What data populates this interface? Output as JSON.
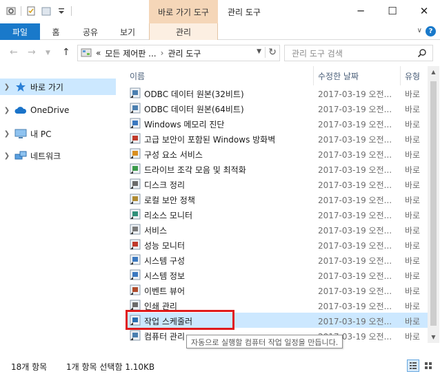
{
  "title_bar": {
    "context_tab": "바로 가기 도구",
    "window_title": "관리 도구",
    "minimize": "─",
    "maximize": "☐",
    "close": "✕"
  },
  "ribbon": {
    "tabs": [
      "파일",
      "홈",
      "공유",
      "보기",
      "관리"
    ]
  },
  "address": {
    "overflow": "«",
    "crumbs": [
      "모든 제어판 ...",
      "관리 도구"
    ],
    "separator": "›",
    "search_placeholder": "관리 도구 검색"
  },
  "nav_pane": {
    "items": [
      {
        "label": "바로 가기",
        "icon": "star-icon"
      },
      {
        "label": "OneDrive",
        "icon": "cloud-icon"
      },
      {
        "label": "내 PC",
        "icon": "monitor-icon"
      },
      {
        "label": "네트워크",
        "icon": "network-icon"
      }
    ]
  },
  "columns": {
    "name": "이름",
    "date": "수정한 날짜",
    "type": "유형"
  },
  "files": [
    {
      "name": "ODBC 데이터 원본(32비트)",
      "date": "2017-03-19 오전...",
      "type": "바로"
    },
    {
      "name": "ODBC 데이터 원본(64비트)",
      "date": "2017-03-19 오전...",
      "type": "바로"
    },
    {
      "name": "Windows 메모리 진단",
      "date": "2017-03-19 오전...",
      "type": "바로"
    },
    {
      "name": "고급 보안이 포함된 Windows 방화벽",
      "date": "2017-03-19 오전...",
      "type": "바로"
    },
    {
      "name": "구성 요소 서비스",
      "date": "2017-03-19 오전...",
      "type": "바로"
    },
    {
      "name": "드라이브 조각 모음 및 최적화",
      "date": "2017-03-19 오전...",
      "type": "바로"
    },
    {
      "name": "디스크 정리",
      "date": "2017-03-19 오전...",
      "type": "바로"
    },
    {
      "name": "로컬 보안 정책",
      "date": "2017-03-19 오전...",
      "type": "바로"
    },
    {
      "name": "리소스 모니터",
      "date": "2017-03-19 오전...",
      "type": "바로"
    },
    {
      "name": "서비스",
      "date": "2017-03-19 오전...",
      "type": "바로"
    },
    {
      "name": "성능 모니터",
      "date": "2017-03-19 오전...",
      "type": "바로"
    },
    {
      "name": "시스템 구성",
      "date": "2017-03-19 오전...",
      "type": "바로"
    },
    {
      "name": "시스템 정보",
      "date": "2017-03-19 오전...",
      "type": "바로"
    },
    {
      "name": "이벤트 뷰어",
      "date": "2017-03-19 오전...",
      "type": "바로"
    },
    {
      "name": "인쇄 관리",
      "date": "2017-03-19 오전...",
      "type": "바로"
    },
    {
      "name": "작업 스케줄러",
      "date": "2017-03-19 오전...",
      "type": "바로"
    },
    {
      "name": "컴퓨터 관리",
      "date": "2017-03-19 오전...",
      "type": "바로"
    }
  ],
  "tooltip": "자동으로 실행할 컴퓨터 작업 일정을 만듭니다.",
  "status": {
    "count": "18개 항목",
    "selection": "1개 항목 선택함 1.10KB"
  },
  "colors": {
    "accent": "#1979ca",
    "selection": "#cce8ff",
    "context_tab": "#f5d6b8",
    "highlight": "#e01b1b"
  }
}
